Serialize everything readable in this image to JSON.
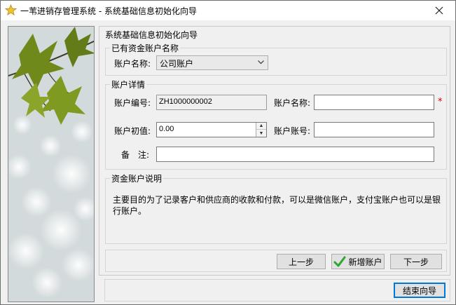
{
  "window": {
    "title": "一苇进销存管理系统 - 系统基础信息初始化向导"
  },
  "panel": {
    "title": "系统基础信息初始化向导"
  },
  "existing_account": {
    "group_title": "已有资金账户名称",
    "name_label": "账户名称:",
    "selected": "公司账户"
  },
  "details": {
    "group_title": "账户详情",
    "code_label": "账户编号:",
    "code_value": "ZH1000000002",
    "name_label": "账户名称:",
    "name_value": "",
    "initial_label": "账户初值:",
    "initial_value": "0.00",
    "account_no_label": "账户账号:",
    "account_no_value": "",
    "note_label": "备　注:",
    "note_value": "",
    "required_mark": "*"
  },
  "description": {
    "group_title": "资金账户说明",
    "text": "主要目的为了记录客户和供应商的收款和付款，可以是微信账户，支付宝账户也可以是银行账户。"
  },
  "buttons": {
    "prev": "上一步",
    "add": "新增账户",
    "next": "下一步",
    "finish": "结束向导"
  },
  "colors": {
    "accent": "#0078d7",
    "required": "#dd0000"
  }
}
